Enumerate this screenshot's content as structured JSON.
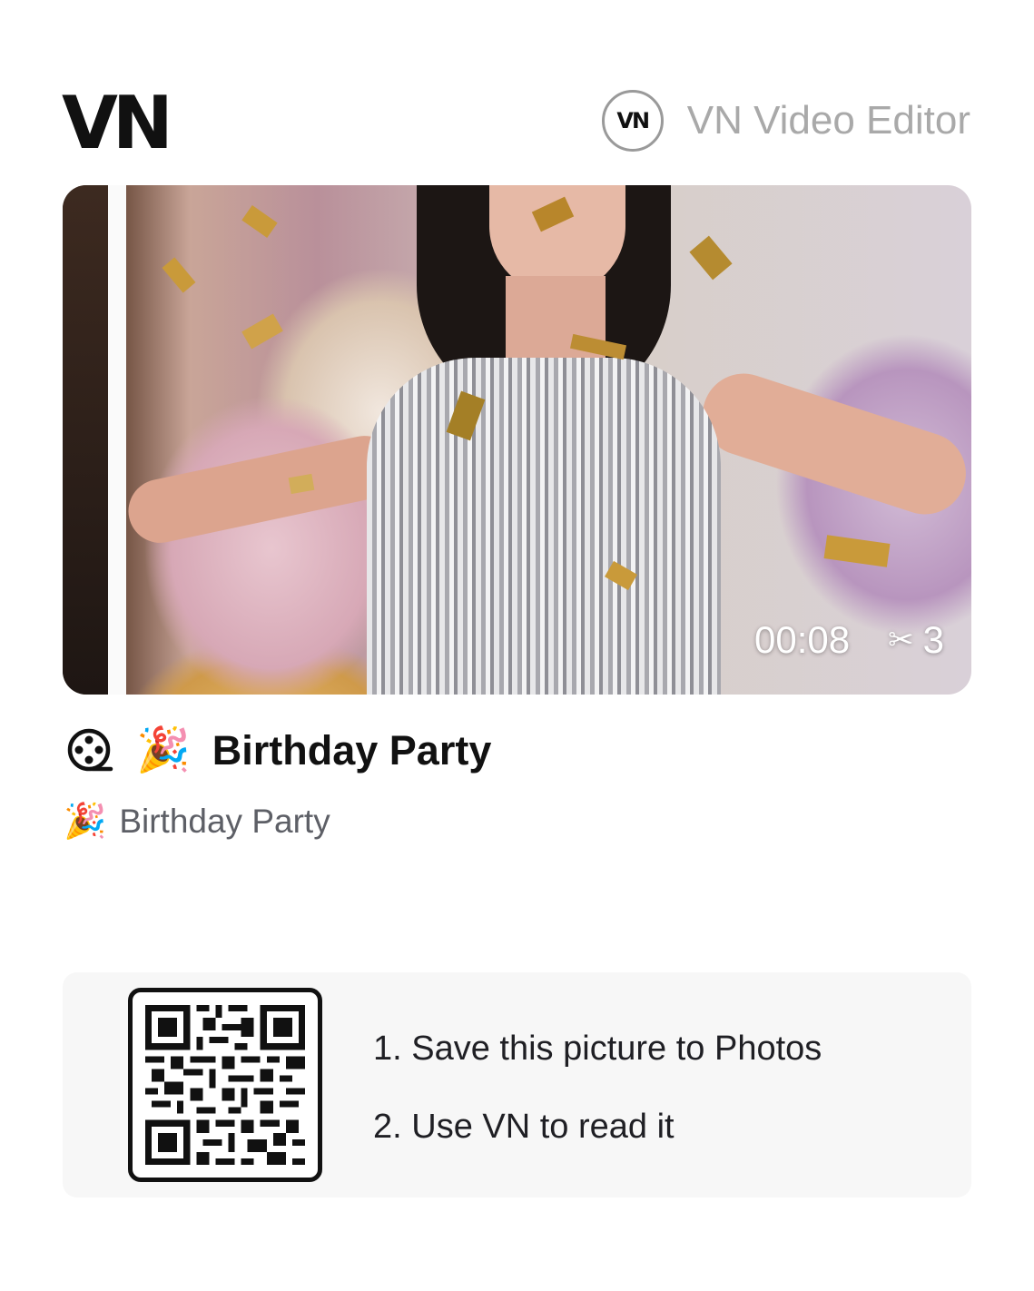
{
  "header": {
    "logo_text": "VN",
    "brand_badge": "VN",
    "brand_name": "VN Video Editor"
  },
  "project": {
    "duration": "00:08",
    "cut_count": "3",
    "title_emoji": "🎉",
    "title": "Birthday Party",
    "subtitle_emoji": "🎉",
    "subtitle": "Birthday Party"
  },
  "qr_section": {
    "steps": [
      "1. Save this picture to Photos",
      "2. Use VN to read it"
    ]
  },
  "icons": {
    "project": "film-reel-icon",
    "cuts": "scissors-icon"
  },
  "colors": {
    "text_primary": "#111111",
    "text_secondary": "#5d5f66",
    "brand_name": "#a9a9a9",
    "panel_bg": "#f7f7f7"
  }
}
